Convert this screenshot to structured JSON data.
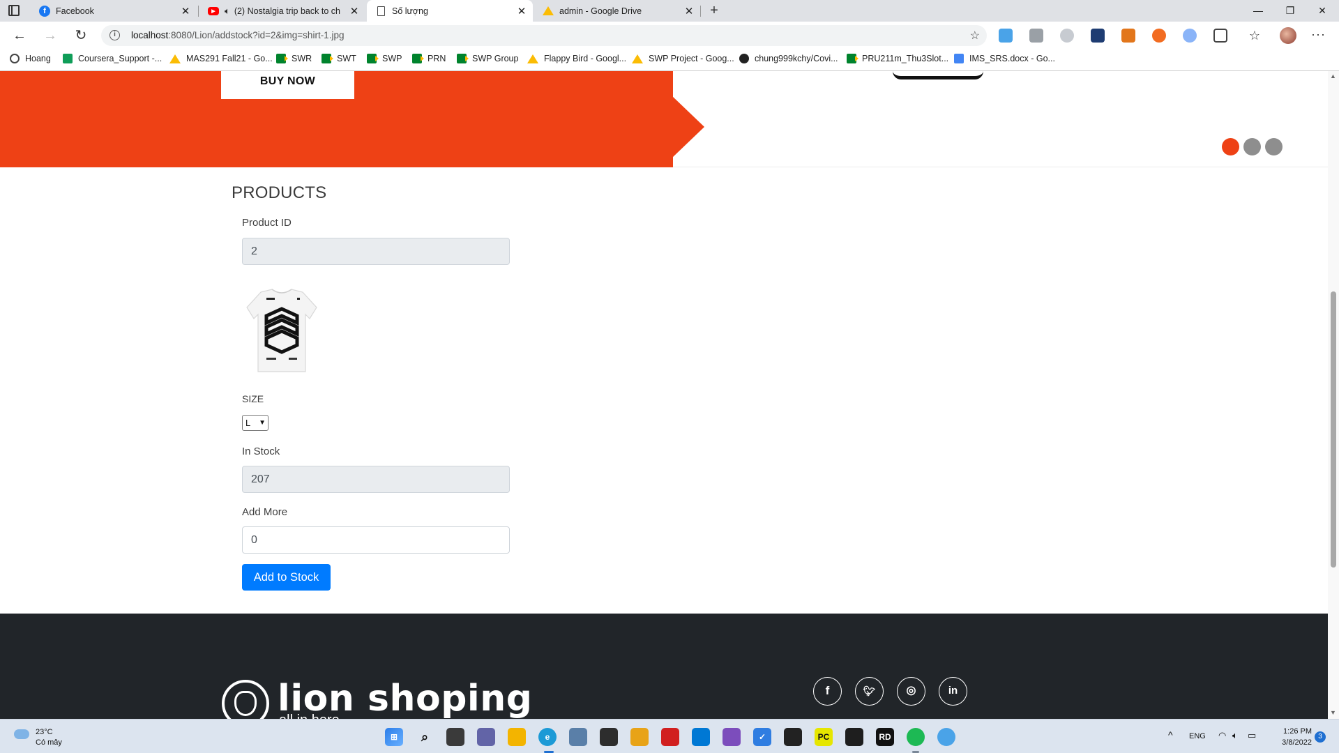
{
  "browser": {
    "tabs": [
      {
        "title": "Facebook",
        "icon": "facebook-icon"
      },
      {
        "title": "(2) Nostalgia trip back to ch",
        "icon": "youtube-icon",
        "audio": true
      },
      {
        "title": "Số lượng",
        "icon": "document-icon",
        "active": true
      },
      {
        "title": "admin - Google Drive",
        "icon": "google-drive-icon"
      }
    ],
    "url_host": "localhost",
    "url_rest": ":8080/Lion/addstock?id=2&img=shirt-1.jpg",
    "bookmarks": [
      {
        "label": "Hoang",
        "icon": "profile-icon"
      },
      {
        "label": "Coursera_Support -...",
        "icon": "classroom-icon"
      },
      {
        "label": "MAS291 Fall21 - Go...",
        "icon": "google-drive-icon"
      },
      {
        "label": "SWR",
        "icon": "google-meet-icon"
      },
      {
        "label": "SWT",
        "icon": "google-meet-icon"
      },
      {
        "label": "SWP",
        "icon": "google-meet-icon"
      },
      {
        "label": "PRN",
        "icon": "google-meet-icon"
      },
      {
        "label": "SWP Group",
        "icon": "google-meet-icon"
      },
      {
        "label": "Flappy Bird - Googl...",
        "icon": "google-drive-icon"
      },
      {
        "label": "SWP Project - Goog...",
        "icon": "google-drive-icon"
      },
      {
        "label": "chung999kchy/Covi...",
        "icon": "github-icon"
      },
      {
        "label": "PRU211m_Thu3Slot...",
        "icon": "google-meet-icon"
      },
      {
        "label": "IMS_SRS.docx - Go...",
        "icon": "google-docs-icon"
      }
    ]
  },
  "banner": {
    "buy_now": "BUY NOW",
    "accent": "#ee4115",
    "carousel_dots": 3,
    "carousel_active_index": 0
  },
  "form": {
    "title": "PRODUCTS",
    "product_id_label": "Product ID",
    "product_id_value": "2",
    "size_label": "SIZE",
    "size_value": "L",
    "in_stock_label": "In Stock",
    "in_stock_value": "207",
    "add_more_label": "Add More",
    "add_more_value": "0",
    "submit_label": "Add to Stock",
    "submit_color": "#007bff"
  },
  "footer": {
    "brand": "lion shoping",
    "tagline": "all in here",
    "socials": [
      "facebook-icon",
      "twitter-icon",
      "instagram-icon",
      "linkedin-icon"
    ]
  },
  "taskbar": {
    "temperature": "23°C",
    "weather": "Có mây",
    "language": "ENG",
    "time": "1:26 PM",
    "date": "3/8/2022",
    "notifications": "3"
  }
}
